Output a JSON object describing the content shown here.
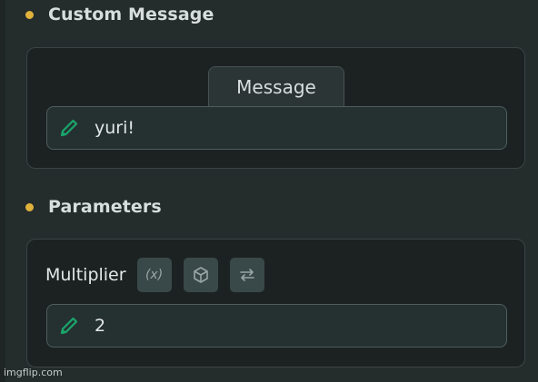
{
  "custom_message": {
    "title": "Custom Message",
    "tab_label": "Message",
    "field_value": "yuri!",
    "field_icon": "pencil-icon"
  },
  "parameters": {
    "title": "Parameters",
    "multiplier_label": "Multiplier",
    "variable_button_label": "(x)",
    "buttons": [
      "variable-icon",
      "cube-icon",
      "swap-arrows-icon"
    ],
    "field_value": "2",
    "field_icon": "pencil-icon"
  },
  "watermark": "imgflip.com",
  "colors": {
    "background": "#252c2c",
    "panel": "#1c2222",
    "field": "#253131",
    "accent_dot": "#e0b23c",
    "pencil": "#1aa56b"
  }
}
